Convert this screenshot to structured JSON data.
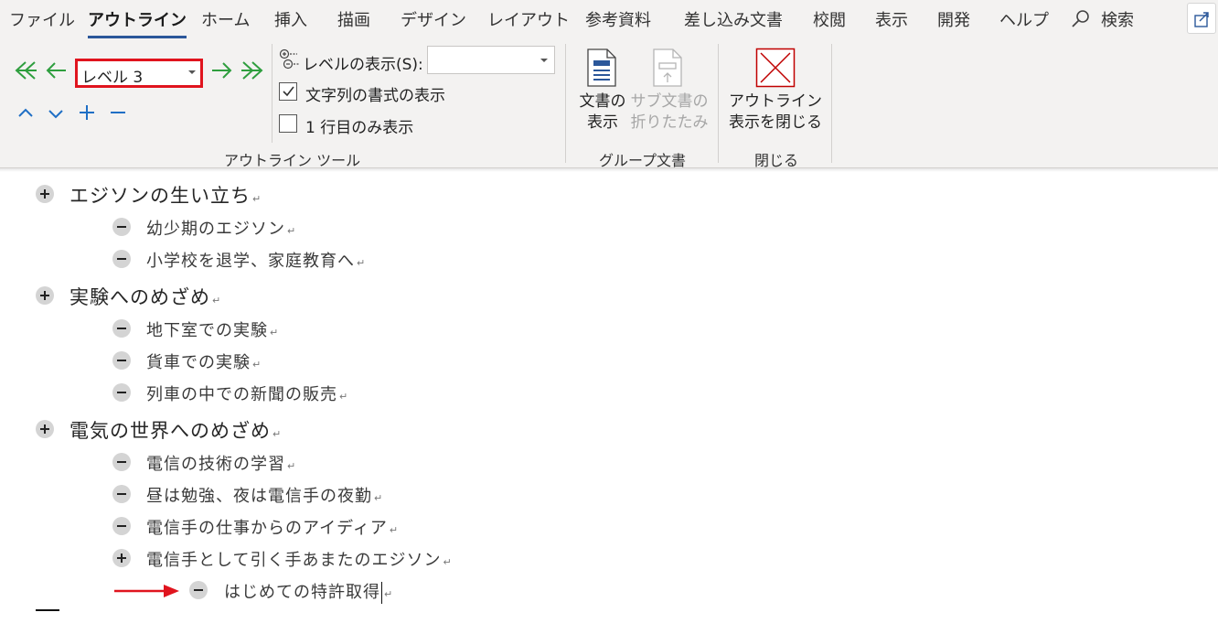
{
  "menu": {
    "tabs": [
      "ファイル",
      "アウトライン",
      "ホーム",
      "挿入",
      "描画",
      "デザイン",
      "レイアウト",
      "参考資料",
      "差し込み文書",
      "校閲",
      "表示",
      "開発",
      "ヘルプ"
    ],
    "active_tab": "アウトライン",
    "search_label": "検索",
    "search_icon": "search-icon",
    "share_icon": "share-icon"
  },
  "ribbon": {
    "outline_tools": {
      "group_label": "アウトライン ツール",
      "level_select_value": "レベル 3",
      "show_level_label": "レベルの表示(S):",
      "show_level_value": "",
      "show_text_formatting_label": "文字列の書式の表示",
      "show_text_formatting_checked": true,
      "show_first_line_only_label": "1 行目のみ表示",
      "show_first_line_only_checked": false,
      "icons": [
        "promote-to-heading1-icon",
        "promote-icon",
        "demote-icon",
        "demote-to-body-icon",
        "move-up-icon",
        "move-down-icon",
        "expand-icon",
        "collapse-icon"
      ]
    },
    "master_document": {
      "group_label": "グループ文書",
      "show_document_label": [
        "文書の",
        "表示"
      ],
      "collapse_subdocuments_label": [
        "サブ文書の",
        "折りたたみ"
      ]
    },
    "close": {
      "group_label": "閉じる",
      "close_outline_label": [
        "アウトライン",
        "表示を閉じる"
      ]
    }
  },
  "outline": [
    {
      "level": 1,
      "bullet": "plus",
      "text": "エジソンの生い立ち"
    },
    {
      "level": 2,
      "bullet": "minus",
      "text": "幼少期のエジソン"
    },
    {
      "level": 2,
      "bullet": "minus",
      "text": "小学校を退学、家庭教育へ"
    },
    {
      "level": 1,
      "bullet": "plus",
      "text": "実験へのめざめ"
    },
    {
      "level": 2,
      "bullet": "minus",
      "text": "地下室での実験"
    },
    {
      "level": 2,
      "bullet": "minus",
      "text": "貨車での実験"
    },
    {
      "level": 2,
      "bullet": "minus",
      "text": "列車の中での新聞の販売"
    },
    {
      "level": 1,
      "bullet": "plus",
      "text": "電気の世界へのめざめ"
    },
    {
      "level": 2,
      "bullet": "minus",
      "text": "電信の技術の学習"
    },
    {
      "level": 2,
      "bullet": "minus",
      "text": "昼は勉強、夜は電信手の夜勤"
    },
    {
      "level": 2,
      "bullet": "minus",
      "text": "電信手の仕事からのアイディア"
    },
    {
      "level": 2,
      "bullet": "plus",
      "text": "電信手として引く手あまたのエジソン"
    },
    {
      "level": 3,
      "bullet": "minus",
      "text": "はじめての特許取得",
      "has_cursor": true
    }
  ],
  "colors": {
    "accent_blue": "#2b579a",
    "arrow_green": "#2e9e3e",
    "arrow_blue": "#1f6fc5",
    "highlight_red": "#e0141e",
    "ribbon_bg": "#f3f2f1"
  }
}
